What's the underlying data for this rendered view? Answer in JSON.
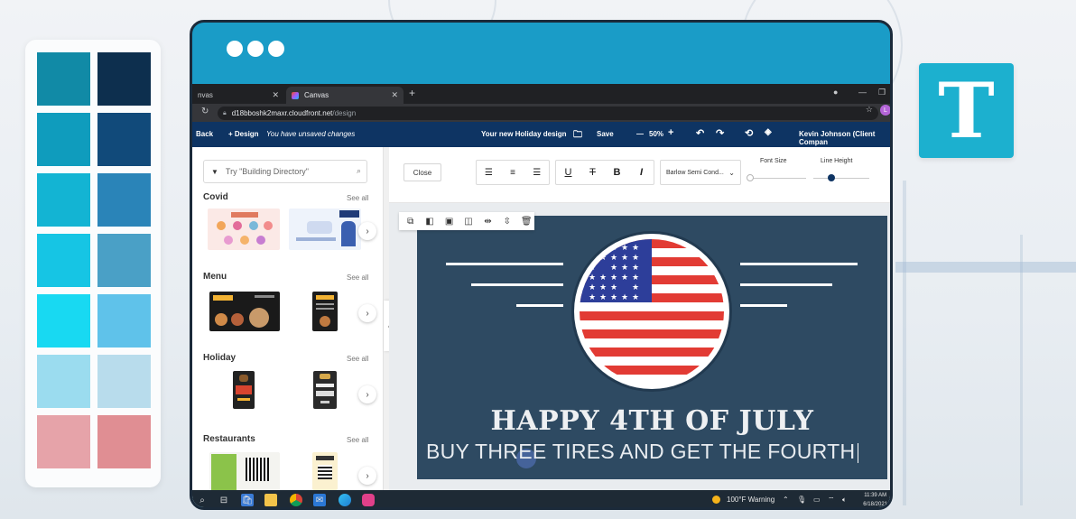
{
  "palette": {
    "colors": [
      "#118aa6",
      "#0d2f4e",
      "#0f9cbd",
      "#114a7a",
      "#13b4d3",
      "#2a84b8",
      "#16c5e4",
      "#4aa0c6",
      "#18d9f2",
      "#5fc2ea",
      "#9bdcef",
      "#b8dcec",
      "#e6a3a9",
      "#e08e93"
    ]
  },
  "browser": {
    "tab_inactive": "nvas",
    "tab_active": "Canvas",
    "url_host": "d18bboshk2maxr.cloudfront.net",
    "url_path": "/design",
    "profile_initial": "L"
  },
  "app_header": {
    "back": "Back",
    "design_menu": "+ Design",
    "unsaved": "You have unsaved changes",
    "design_name": "Your new Holiday design",
    "save": "Save",
    "zoom": "50%",
    "user": "Kevin Johnson (Client Compan"
  },
  "left_panel": {
    "search_placeholder": "Try \"Building Directory\"",
    "see_all": "See all",
    "categories": [
      "Covid",
      "Menu",
      "Holiday",
      "Restaurants"
    ]
  },
  "toolbar": {
    "close": "Close",
    "font": "Barlow Semi Cond...",
    "font_size_label": "Font Size",
    "line_height_label": "Line Height",
    "font_size_level": 0.0,
    "line_height_level": 0.33,
    "accent": "#0e3463"
  },
  "design": {
    "headline": "HAPPY 4TH OF JULY",
    "subline": "BUY THREE TIRES AND GET THE FOURTH",
    "background": "#2e4a62"
  },
  "taskbar": {
    "weather": "100°F  Warning",
    "time": "11:39 AM",
    "date": "6/18/2021"
  }
}
